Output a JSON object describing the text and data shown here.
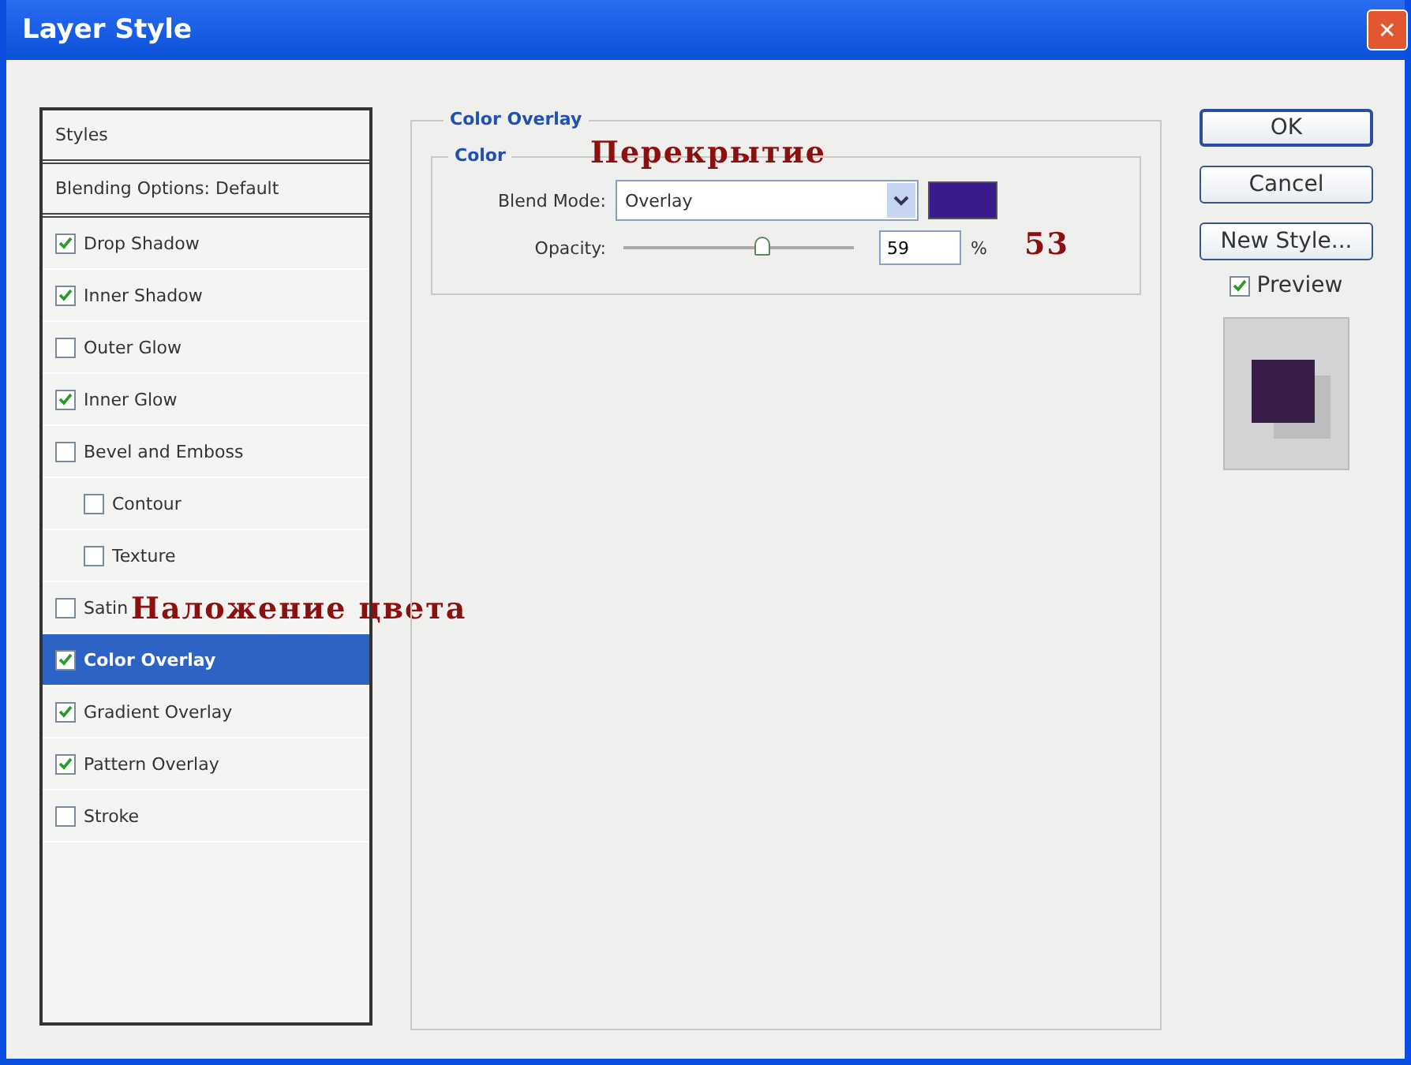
{
  "window": {
    "title": "Layer Style",
    "close": "✕"
  },
  "styles_list": {
    "header": "Styles",
    "blending": "Blending Options: Default",
    "items": [
      {
        "label": "Drop Shadow",
        "checked": true,
        "selected": false,
        "indent": false
      },
      {
        "label": "Inner Shadow",
        "checked": true,
        "selected": false,
        "indent": false
      },
      {
        "label": "Outer Glow",
        "checked": false,
        "selected": false,
        "indent": false
      },
      {
        "label": "Inner Glow",
        "checked": true,
        "selected": false,
        "indent": false
      },
      {
        "label": "Bevel and Emboss",
        "checked": false,
        "selected": false,
        "indent": false
      },
      {
        "label": "Contour",
        "checked": false,
        "selected": false,
        "indent": true
      },
      {
        "label": "Texture",
        "checked": false,
        "selected": false,
        "indent": true
      },
      {
        "label": "Satin",
        "checked": false,
        "selected": false,
        "indent": false,
        "note": "Наложение цвета"
      },
      {
        "label": "Color Overlay",
        "checked": true,
        "selected": true,
        "indent": false
      },
      {
        "label": "Gradient Overlay",
        "checked": true,
        "selected": false,
        "indent": false
      },
      {
        "label": "Pattern Overlay",
        "checked": true,
        "selected": false,
        "indent": false
      },
      {
        "label": "Stroke",
        "checked": false,
        "selected": false,
        "indent": false
      }
    ]
  },
  "panel": {
    "title": "Color Overlay",
    "group": "Color",
    "group_note": "Перекрытие",
    "opacity_note": "53",
    "blend_mode": {
      "label": "Blend Mode:",
      "value": "Overlay",
      "color": "#3a1a8c"
    },
    "opacity": {
      "label": "Opacity:",
      "level": 0.6,
      "value": "59",
      "unit": "%"
    }
  },
  "buttons": [
    {
      "label": "OK",
      "default": true
    },
    {
      "label": "Cancel",
      "default": false
    },
    {
      "label": "New Style...",
      "default": false
    }
  ],
  "preview": {
    "label": "Preview",
    "checked": true
  }
}
